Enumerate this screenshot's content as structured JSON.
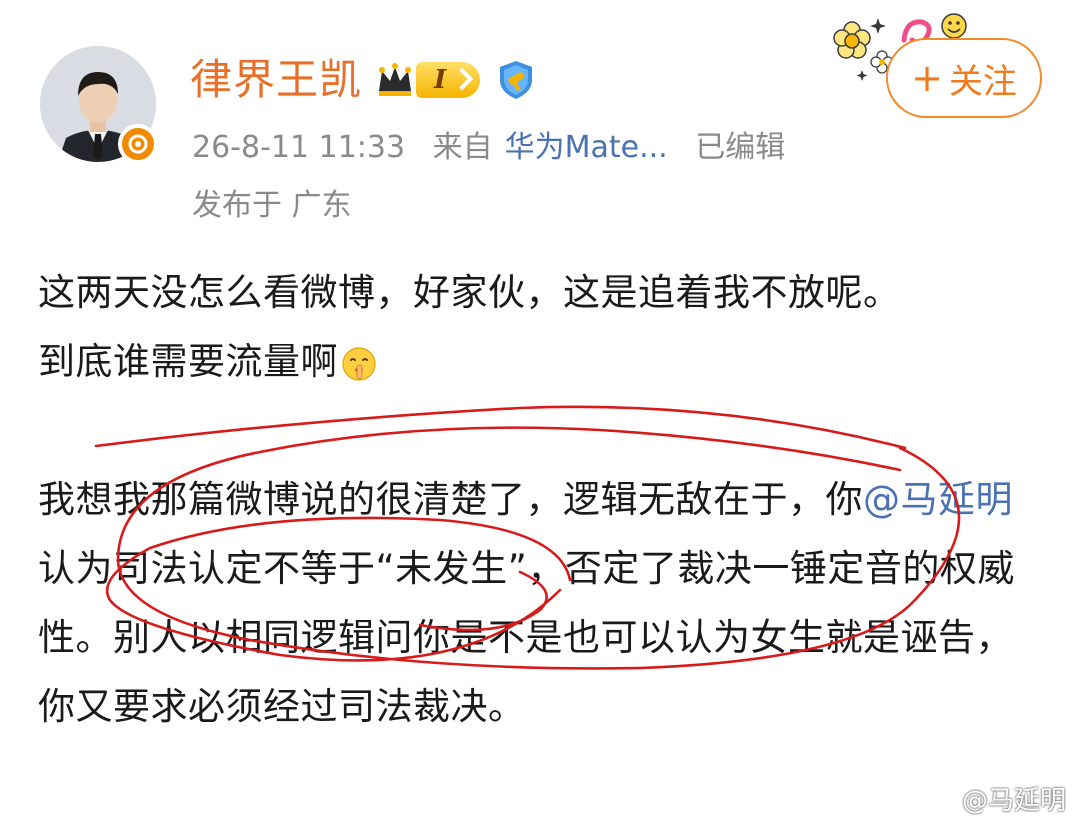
{
  "user": {
    "name": "律界王凯",
    "level": "I"
  },
  "post_meta": {
    "time": "26-8-11 11:33",
    "source_prefix": "来自",
    "source": "华为Mate...",
    "edited": "已编辑",
    "location": "发布于 广东"
  },
  "follow": {
    "plus": "+",
    "label": "关注"
  },
  "post": {
    "line1": "这两天没怎么看微博，好家伙，这是追着我不放呢。",
    "line2": "到底谁需要流量啊",
    "p2_start": "我想我那篇微博说的很清楚了，逻辑无敌在于，你",
    "mention": "@马延明",
    "p2_end": " 认为司法认定不等于“未发生”，否定了裁决一锤定音的权威性。别人以相同逻辑问你是不是也可以认为女生就是诬告，你又要求必须经过司法裁决。"
  },
  "watermark": {
    "text": "@马延明"
  },
  "icons": {
    "crown": "crown-icon",
    "shield": "verified-shield-icon",
    "emoji": "shush-emoji-icon",
    "sticker": "flower-smile-sticker",
    "weibo": "weibo-logo-icon"
  },
  "colors": {
    "username": "#e86f28",
    "follow_border": "#f08a2a",
    "link": "#4a72b2",
    "meta": "#8a8a8a",
    "scribble": "#d81a1a"
  }
}
